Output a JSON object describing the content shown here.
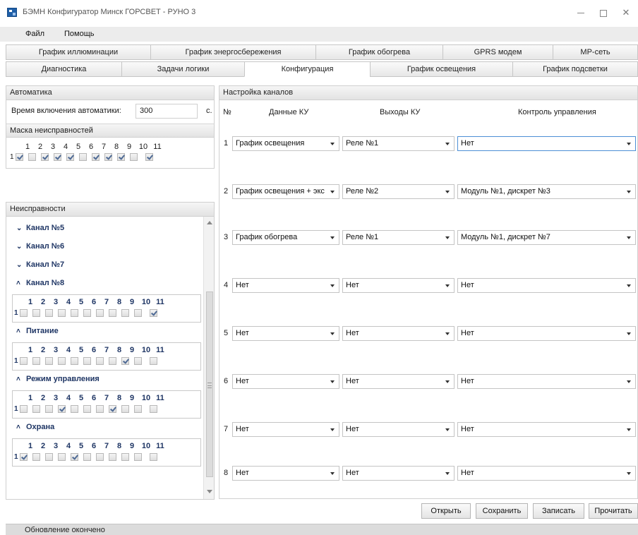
{
  "window": {
    "title": "БЭМН Конфигуратор Минск ГОРСВЕТ - РУНО 3"
  },
  "menu": {
    "file": "Файл",
    "help": "Помощь"
  },
  "tabs_row1": [
    "График иллюминации",
    "График энергосбережения",
    "График обогрева",
    "GPRS модем",
    "MP-сеть"
  ],
  "tabs_row2": [
    "Диагностика",
    "Задачи логики",
    "Конфигурация",
    "График освещения",
    "График подсветки"
  ],
  "active_tab": "Конфигурация",
  "automation": {
    "header": "Автоматика",
    "time_label": "Время включения автоматики:",
    "time_value": "300",
    "time_unit": "с.",
    "mask_header": "Маска неисправностей",
    "numbers": [
      "1",
      "2",
      "3",
      "4",
      "5",
      "6",
      "7",
      "8",
      "9",
      "10",
      "11"
    ],
    "row_label": "1",
    "mask_checked": [
      true,
      false,
      true,
      true,
      true,
      false,
      true,
      true,
      true,
      false,
      true
    ]
  },
  "faults": {
    "header": "Неисправности",
    "collapsed": [
      "Канал №5",
      "Канал №6",
      "Канал №7"
    ],
    "groups": [
      {
        "title": "Канал №8",
        "row_label": "1",
        "checked": [
          false,
          false,
          false,
          false,
          false,
          false,
          false,
          false,
          false,
          false,
          true
        ]
      },
      {
        "title": "Питание",
        "row_label": "1",
        "checked": [
          false,
          false,
          false,
          false,
          false,
          false,
          false,
          false,
          true,
          false,
          false
        ]
      },
      {
        "title": "Режим управления",
        "row_label": "1",
        "checked": [
          false,
          false,
          false,
          true,
          false,
          false,
          false,
          true,
          false,
          false,
          false
        ]
      },
      {
        "title": "Охрана",
        "row_label": "1",
        "checked": [
          true,
          false,
          false,
          false,
          true,
          false,
          false,
          false,
          false,
          false,
          false
        ]
      }
    ],
    "numbers": [
      "1",
      "2",
      "3",
      "4",
      "5",
      "6",
      "7",
      "8",
      "9",
      "10",
      "11"
    ]
  },
  "channels": {
    "header": "Настройка каналов",
    "col_num": "№",
    "col_data": "Данные КУ",
    "col_outputs": "Выходы КУ",
    "col_control": "Контроль управления",
    "rows": [
      {
        "num": "1",
        "data": "График освещения",
        "output": "Реле №1",
        "control": "Нет"
      },
      {
        "num": "2",
        "data": "График освещения + экс",
        "output": "Реле №2",
        "control": "Модуль №1, дискрет №3"
      },
      {
        "num": "3",
        "data": "График обогрева",
        "output": "Реле №1",
        "control": "Модуль №1, дискрет №7"
      },
      {
        "num": "4",
        "data": "Нет",
        "output": "Нет",
        "control": "Нет"
      },
      {
        "num": "5",
        "data": "Нет",
        "output": "Нет",
        "control": "Нет"
      },
      {
        "num": "6",
        "data": "Нет",
        "output": "Нет",
        "control": "Нет"
      },
      {
        "num": "7",
        "data": "Нет",
        "output": "Нет",
        "control": "Нет"
      },
      {
        "num": "8",
        "data": "Нет",
        "output": "Нет",
        "control": "Нет"
      }
    ]
  },
  "buttons": {
    "open": "Открыть",
    "save": "Сохранить",
    "write": "Записать",
    "read": "Прочитать"
  },
  "status": {
    "text": "Обновление окончено"
  },
  "colors": {
    "accent_text": "#1e3564",
    "focus_border": "#4c8fd6",
    "check_mark": "#4e6a95"
  }
}
